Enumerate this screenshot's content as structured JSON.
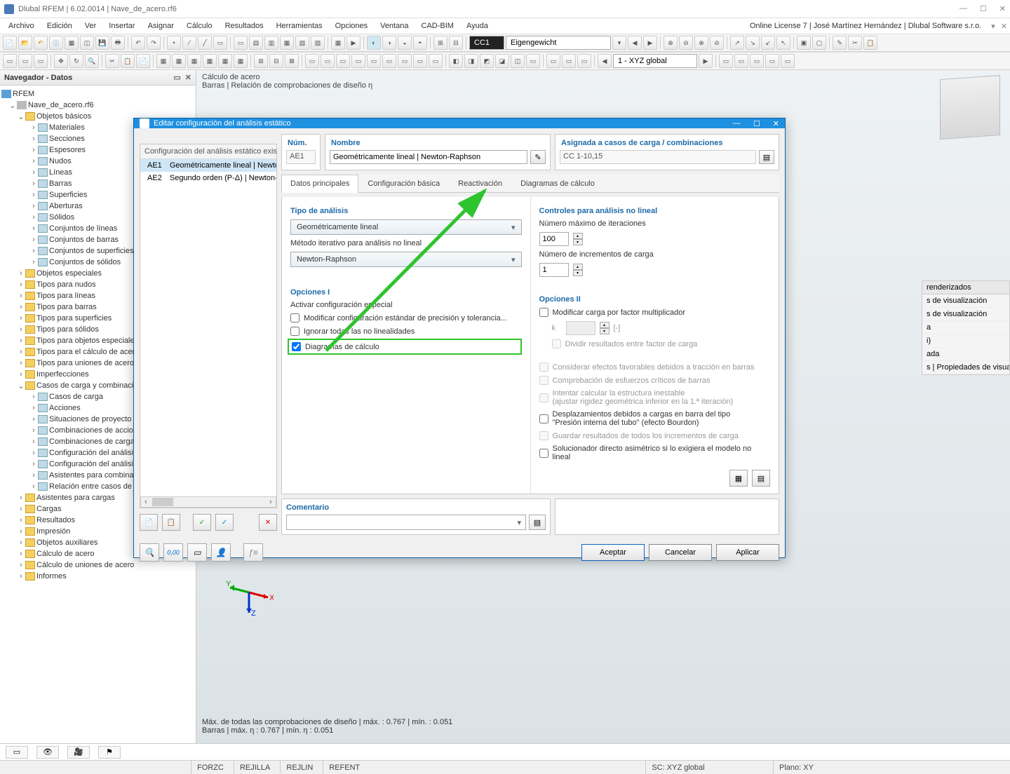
{
  "app": {
    "title": "Dlubal RFEM | 6.02.0014 | Nave_de_acero.rf6"
  },
  "window_buttons": {
    "min": "—",
    "max": "☐",
    "close": "✕"
  },
  "menu": [
    "Archivo",
    "Edición",
    "Ver",
    "Insertar",
    "Asignar",
    "Cálculo",
    "Resultados",
    "Herramientas",
    "Opciones",
    "Ventana",
    "CAD-BIM",
    "Ayuda"
  ],
  "menu_right": "Online License 7 | José Martínez Hernández | Dlubal Software s.r.o.",
  "toolbar2": {
    "cc_label": "CC1",
    "load_case": "Eigengewicht",
    "view_combo": "1 - XYZ global"
  },
  "navigator": {
    "title": "Navegador - Datos",
    "root": "RFEM",
    "project": "Nave_de_acero.rf6",
    "groups": {
      "objetos_basicos": "Objetos básicos",
      "basic_items": [
        "Materiales",
        "Secciones",
        "Espesores",
        "Nudos",
        "Líneas",
        "Barras",
        "Superficies",
        "Aberturas",
        "Sólidos",
        "Conjuntos de líneas",
        "Conjuntos de barras",
        "Conjuntos de superficies",
        "Conjuntos de sólidos"
      ],
      "sections": [
        "Objetos especiales",
        "Tipos para nudos",
        "Tipos para líneas",
        "Tipos para barras",
        "Tipos para superficies",
        "Tipos para sólidos",
        "Tipos para objetos especiales",
        "Tipos para el cálculo de acero",
        "Tipos para uniones de acero",
        "Imperfecciones"
      ],
      "casos": "Casos de carga y combinaciones",
      "casos_items": [
        "Casos de carga",
        "Acciones",
        "Situaciones de proyecto",
        "Combinaciones de acciones",
        "Combinaciones de carga",
        "Configuración del análisis estático",
        "Configuración del análisis de estabilidad",
        "Asistentes para combinatoria",
        "Relación entre casos de carga"
      ],
      "after": [
        "Asistentes para cargas",
        "Cargas",
        "Resultados",
        "Impresión",
        "Objetos auxiliares",
        "Cálculo de acero",
        "Cálculo de uniones de acero",
        "Informes"
      ]
    }
  },
  "viewport": {
    "top1": "Cálculo de acero",
    "top2": "Barras | Relación de comprobaciones de diseño η",
    "bot1": "Máx. de todas las comprobaciones de diseño | máx.  : 0.767 | mín.  : 0.051",
    "bot2": "Barras | máx. η : 0.767 | mín. η : 0.051",
    "axes": {
      "x": "X",
      "y": "Y",
      "z": "Z"
    }
  },
  "floatpanel": {
    "header": "renderizados",
    "rows": [
      "s de visualización",
      "s de visualización",
      "a",
      "i)",
      "ada",
      "s | Propiedades de visual..."
    ]
  },
  "dialog": {
    "title": "Editar configuración del análisis estático",
    "list_header": "Configuración del análisis estático existente",
    "list_rows": [
      {
        "num": "AE1",
        "name": "Geométricamente lineal | Newton-Raphson",
        "color": "#8fd6e8"
      },
      {
        "num": "AE2",
        "name": "Segundo orden (P-Δ) | Newton-Raphson",
        "color": "#e8a030"
      }
    ],
    "num_header": "Núm.",
    "num_value": "AE1",
    "name_header": "Nombre",
    "name_value": "Geométricamente lineal | Newton-Raphson",
    "assigned_header": "Asignada a casos de carga / combinaciones",
    "assigned_value": "CC 1-10,15",
    "tabs": [
      "Datos principales",
      "Configuración básica",
      "Reactivación",
      "Diagramas de cálculo"
    ],
    "left_pane": {
      "sect1": "Tipo de análisis",
      "combo1": "Geométricamente lineal",
      "lbl_method": "Método iterativo para análisis no lineal",
      "combo2": "Newton-Raphson",
      "sect2": "Opciones I",
      "lbl_activate": "Activar configuración especial",
      "chk1": "Modificar configuración estándar de precisión y tolerancia...",
      "chk2": "Ignorar todas las no linealidades",
      "chk3": "Diagramas de cálculo"
    },
    "right_pane": {
      "sect1": "Controles para análisis no lineal",
      "lbl_iter": "Número máximo de iteraciones",
      "val_iter": "100",
      "lbl_incr": "Número de incrementos de carga",
      "val_incr": "1",
      "sect2": "Opciones II",
      "chk1": "Modificar carga por factor multiplicador",
      "k_label": "k",
      "k_unit": "[-]",
      "chk1b": "Dividir resultados entre factor de carga",
      "chk2": "Considerar efectos favorables debidos a tracción en barras",
      "chk3": "Comprobación de esfuerzos críticos de barras",
      "chk4a": "Intentar calcular la estructura inestable",
      "chk4b": "(ajustar rigidez geométrica inferior en la 1.ª iteración)",
      "chk5a": "Desplazamientos debidos a cargas en barra del tipo",
      "chk5b": "\"Presión interna del tubo\" (efecto Bourdon)",
      "chk6": "Guardar resultados de todos los incrementos de carga",
      "chk7": "Solucionador directo asimétrico si lo exigiera el modelo no lineal"
    },
    "comment_header": "Comentario",
    "buttons": {
      "ok": "Aceptar",
      "cancel": "Cancelar",
      "apply": "Aplicar"
    }
  },
  "status": {
    "cells": [
      "FORZC",
      "REJILLA",
      "REJLIN",
      "REFENT"
    ],
    "sc": "SC: XYZ global",
    "plane": "Plano: XY"
  }
}
